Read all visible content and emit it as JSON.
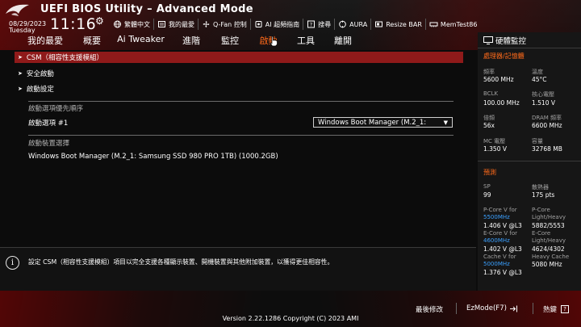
{
  "header": {
    "title": "UEFI BIOS Utility – Advanced Mode",
    "date": "08/29/2023",
    "weekday": "Tuesday",
    "time": "11:16",
    "tools": [
      {
        "label": "繁體中文",
        "icon": "globe-icon"
      },
      {
        "label": "我的最愛",
        "icon": "favorites-icon"
      },
      {
        "label": "Q-Fan 控制",
        "icon": "fan-icon"
      },
      {
        "label": "AI 超頻指南",
        "icon": "ai-icon"
      },
      {
        "label": "搜尋",
        "icon": "search-icon"
      },
      {
        "label": "AURA",
        "icon": "aura-icon"
      },
      {
        "label": "Resize BAR",
        "icon": "resize-bar-icon"
      },
      {
        "label": "MemTest86",
        "icon": "memtest-icon"
      }
    ]
  },
  "tabs": [
    {
      "label": "我的最愛"
    },
    {
      "label": "概要"
    },
    {
      "label": "Ai Tweaker"
    },
    {
      "label": "進階"
    },
    {
      "label": "監控"
    },
    {
      "label": "啟動",
      "active": true
    },
    {
      "label": "工具"
    },
    {
      "label": "離開"
    }
  ],
  "main": {
    "items": [
      {
        "label": "CSM（相容性支援模組）",
        "selected": true
      },
      {
        "label": "安全啟動"
      },
      {
        "label": "啟動設定"
      }
    ],
    "boot_priority_label": "啟動選項優先順序",
    "boot_option_label": "啟動選項 #1",
    "boot_option_value": "Windows Boot Manager (M.2_1:",
    "boot_override_label": "啟動裝置選擇",
    "boot_override_device": "Windows Boot Manager (M.2_1: Samsung SSD 980 PRO 1TB) (1000.2GB)"
  },
  "info": {
    "text": "設定 CSM（相容性支援模組）項目以完全支援各種顯示裝置、開機裝置與其他附加裝置，以獲得更佳相容性。"
  },
  "hw_monitor": {
    "title": "硬體監控",
    "cpu_memory": {
      "title": "處理器/記憶體",
      "freq_label": "頻率",
      "freq": "5600 MHz",
      "temp_label": "溫度",
      "temp": "45°C",
      "bclk_label": "BCLK",
      "bclk": "100.00 MHz",
      "vcore_label": "核心電壓",
      "vcore": "1.510 V",
      "ratio_label": "倍頻",
      "ratio": "56x",
      "dram_label": "DRAM 頻率",
      "dram": "6600 MHz",
      "mc_label": "MC 電壓",
      "mc": "1.350 V",
      "capacity_label": "容量",
      "capacity": "32768 MB"
    },
    "prediction": {
      "title": "預測",
      "sp_label": "SP",
      "sp": "99",
      "cooler_label": "散熱器",
      "cooler": "175 pts",
      "pcore_label": "P-Core V for",
      "pcore_freq": "5500MHz",
      "pcore_v": "1.406 V @L3",
      "pcore_lh_label": "P-Core",
      "pcore_lh_label2": "Light/Heavy",
      "pcore_lh": "5882/5553",
      "ecore_label": "E-Core V for",
      "ecore_freq": "4600MHz",
      "ecore_v": "1.402 V @L3",
      "ecore_lh_label": "E-Core",
      "ecore_lh_label2": "Light/Heavy",
      "ecore_lh": "4624/4302",
      "cache_label": "Cache V for",
      "cache_freq": "5000MHz",
      "cache_v": "1.376 V @L3",
      "cache_hc_label": "Heavy Cache",
      "cache_hc": "5080 MHz"
    }
  },
  "footer": {
    "last_modified": "最後修改",
    "ezmode": "EzMode(F7)",
    "hotkeys": "熱鍵",
    "hotkeys_key": "?",
    "version": "Version 2.22.1286 Copyright (C) 2023 AMI"
  },
  "colors": {
    "accent": "#ff6a1a",
    "selected_row": "#8f1a1a",
    "prediction_highlight": "#3aa0ff"
  }
}
